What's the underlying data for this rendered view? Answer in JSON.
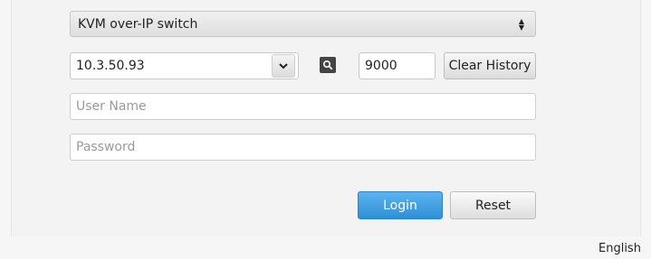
{
  "connection": {
    "device_type": "KVM over-IP switch",
    "ip_address": "10.3.50.93",
    "port": "9000",
    "clear_history_label": "Clear History"
  },
  "credentials": {
    "username_placeholder": "User Name",
    "password_placeholder": "Password"
  },
  "actions": {
    "login_label": "Login",
    "reset_label": "Reset"
  },
  "language": "English",
  "icons": {
    "device_select": "updown-icon",
    "ip_dropdown": "chevron-down-icon",
    "search": "search-icon"
  },
  "colors": {
    "login_button": "#3a97dc",
    "search_button": "#444444"
  }
}
